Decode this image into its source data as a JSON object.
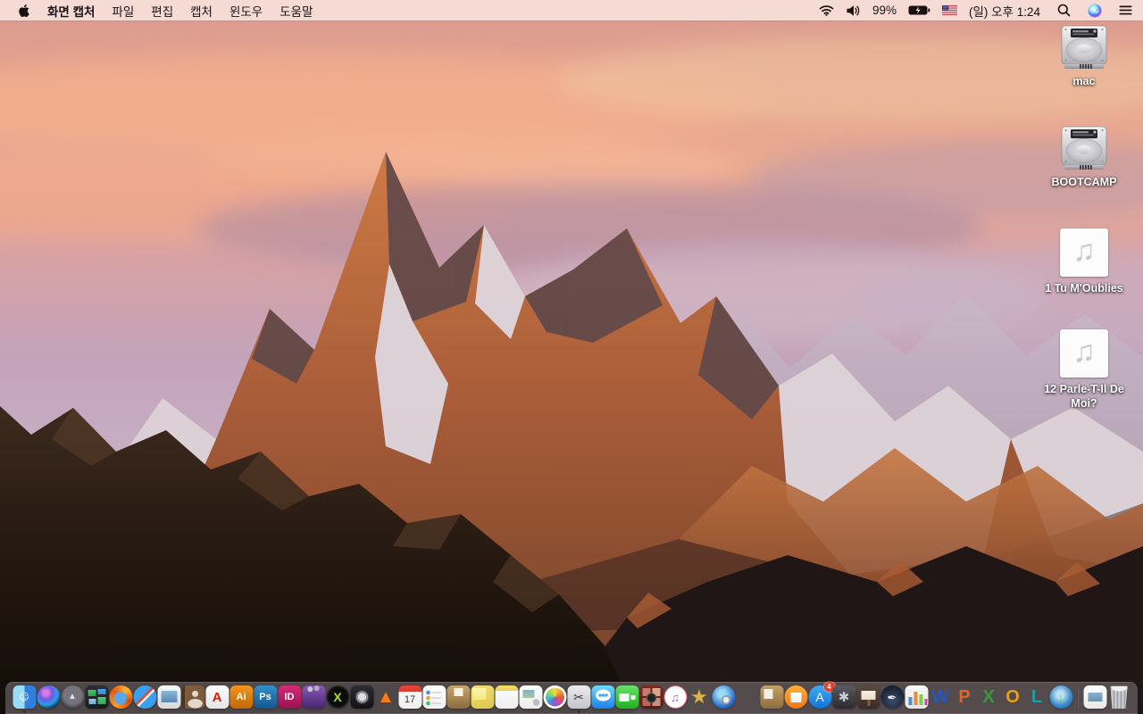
{
  "menu_bar": {
    "app_name": "화면 캡처",
    "menus": [
      "파일",
      "편집",
      "캡처",
      "윈도우",
      "도움말"
    ],
    "status": {
      "battery_percent": "99%",
      "clock": "(일) 오후 1:24",
      "icons": [
        "wifi-icon",
        "volume-icon",
        "battery-charging-icon",
        "us-flag-icon",
        "spotlight-icon",
        "siri-icon",
        "notification-center-icon"
      ]
    }
  },
  "desktop": {
    "icons": [
      {
        "label": "mac",
        "kind": "hard-drive"
      },
      {
        "label": "BOOTCAMP",
        "kind": "hard-drive"
      },
      {
        "label": "1 Tu M'Oublies",
        "kind": "audio-file"
      },
      {
        "label": "12 Parle-T-Il De Moi?",
        "kind": "audio-file"
      }
    ]
  },
  "wallpaper_palette": {
    "sky_top": "#e5a48f",
    "sky_lavender": "#c3a3ba",
    "cloud_pink": "#f4ae8d",
    "mountain_orange": "#c8743f",
    "snow": "#ded7de",
    "foreground_rock": "#241810",
    "menubar_tint": "#f7e0da"
  },
  "dock": {
    "items": [
      {
        "name": "finder",
        "shape": "sq",
        "bg": "linear-gradient(90deg,#9adcf8 0 50%,#2e7fe0 50% 100%)",
        "glyph": "☺",
        "fg": "#ffffff",
        "fs": 16,
        "running": true
      },
      {
        "name": "siri",
        "shape": "round",
        "bg": "radial-gradient(circle at 38% 32%,#e07ae0 0 12%,#6a5ae8 32%,#28a0e8 55%,#101c2e 82%)"
      },
      {
        "name": "launchpad",
        "shape": "round",
        "bg": "radial-gradient(circle at 50% 42%,#74747a 0 50%,#38383e 78%)",
        "glyph": "▲",
        "fg": "#e0e0e6",
        "fs": 10
      },
      {
        "name": "mission-control",
        "shape": "sq",
        "bg": "linear-gradient(#3ec862,#2aa04a) 3px 5px/9px 7px no-repeat,linear-gradient(#4aa8e8,#3a88c8) 14px 4px/9px 6px no-repeat,linear-gradient(#9ac8e8,#6aa8d8) 4px 15px/8px 6px no-repeat,linear-gradient(#52c878,#38a858) 14px 13px/9px 8px no-repeat,linear-gradient(#2e2e34,#1a1a20)"
      },
      {
        "name": "firefox",
        "shape": "round",
        "bg": "radial-gradient(circle at 48% 54%,#58a8e8 0 36%,rgba(0,0,0,0) 38%),conic-gradient(from 210deg,#ff9a1e,#e8580e 28%,#ffb83a 52%,#d84a08 74%,#ff9a1e)"
      },
      {
        "name": "safari",
        "shape": "round",
        "bg": "linear-gradient(135deg,rgba(0,0,0,0) 43%,#e8483c 43% 50%,#f8f8f8 50% 57%,rgba(0,0,0,0) 57%),radial-gradient(circle,#eaf4fc 0 10%,#38a0ee 11% 100%)"
      },
      {
        "name": "preview",
        "shape": "sq",
        "bg": "linear-gradient(#8ab8da,#5a88b2) 4px 6px/18px 13px no-repeat,linear-gradient(#fafafa,#d8d8d8)"
      },
      {
        "name": "contacts",
        "shape": "sq",
        "bg": "radial-gradient(circle at 58% 36%,#e2d6c6 0 15%,rgba(0,0,0,0) 16%),radial-gradient(ellipse 32% 20% at 58% 78%,#e2d6c6 0 99%,rgba(0,0,0,0) 100%),linear-gradient(90deg,#4a3422 0 14%,#7d5c3c 14% 100%)"
      },
      {
        "name": "acrobat-reader",
        "shape": "sq",
        "bg": "linear-gradient(#fdfdfd,#e6e6e6)",
        "glyph": "A",
        "fg": "#d4200e",
        "fs": 15,
        "bold": true
      },
      {
        "name": "adobe-illustrator",
        "shape": "sq",
        "bg": "linear-gradient(#f2951e,#c06808)",
        "glyph": "Ai",
        "fg": "#ffffff",
        "fs": 11,
        "bold": true
      },
      {
        "name": "adobe-photoshop",
        "shape": "sq",
        "bg": "linear-gradient(#3290cc,#16568e)",
        "glyph": "Ps",
        "fg": "#ffffff",
        "fs": 11,
        "bold": true
      },
      {
        "name": "adobe-indesign",
        "shape": "sq",
        "bg": "linear-gradient(#d62a78,#96134e)",
        "glyph": "ID",
        "fg": "#ffffff",
        "fs": 11,
        "bold": true
      },
      {
        "name": "toast-titanium",
        "shape": "sq",
        "bg": "radial-gradient(circle at 34% 16%,#c8c8d2 0 10%,rgba(0,0,0,0) 11%),radial-gradient(circle at 62% 12%,#b0b0c0 0 10%,rgba(0,0,0,0) 11%),linear-gradient(#8a5ab8,#44266e)"
      },
      {
        "name": "media-converter-x",
        "shape": "round",
        "bg": "radial-gradient(circle at 50% 50%,#0c0c0c 0 58%,#3c3c3c 74%)",
        "glyph": "X",
        "fg": "#aadc28",
        "fs": 14,
        "bold": true
      },
      {
        "name": "disc-utility-app",
        "shape": "sq",
        "bg": "radial-gradient(circle at 50% 50%,#dcdce4 0 24%,#8c8c94 25% 36%,#3c3c42 37% 42%,rgba(0,0,0,0) 43%),linear-gradient(#2c2c32,#121216)"
      },
      {
        "name": "vlc",
        "shape": "none",
        "glyph": "▲",
        "fg": "#ff7a14",
        "fs": 20
      },
      {
        "name": "calendar",
        "shape": "sq",
        "bg": "linear-gradient(#e8463c,#d83a30) 0 0/100% 7px no-repeat,linear-gradient(#fdfdfd,#efefef)",
        "glyph": "17",
        "fg": "#333333",
        "fs": 11,
        "pt": 6
      },
      {
        "name": "reminders",
        "shape": "sq",
        "bg": "radial-gradient(circle at 6px 8px,#4a90e8 0 2px,rgba(0,0,0,0) 2.6px),radial-gradient(circle at 6px 14px,#e8a03a 0 2px,rgba(0,0,0,0) 2.6px),radial-gradient(circle at 6px 20px,#3ac85a 0 2px,rgba(0,0,0,0) 2.6px),linear-gradient(#dcdcdc,#dcdcdc) 10px 7px/11px 2px no-repeat,linear-gradient(#dcdcdc,#dcdcdc) 10px 13px/11px 2px no-repeat,linear-gradient(#dcdcdc,#dcdcdc) 10px 19px/11px 2px no-repeat,linear-gradient(#ffffff,#f0f0f0)"
      },
      {
        "name": "stuffit-expander",
        "shape": "sq",
        "bg": "linear-gradient(#f6f2e8,#f6f2e8) 8px 3px/10px 9px no-repeat,linear-gradient(#c8a86c,#8a6a3c)"
      },
      {
        "name": "stickies",
        "shape": "sq",
        "bg": "linear-gradient(#fdf6b2,#f6e87e) 2px 3px/15px 13px no-repeat,linear-gradient(155deg,#f2e278,#dcc44a)"
      },
      {
        "name": "notes",
        "shape": "sq",
        "bg": "linear-gradient(#f5df6a,#eccf55) 0 0/100% 6px no-repeat,linear-gradient(#fefefe,#ededed)"
      },
      {
        "name": "document-viewer-app",
        "shape": "sq",
        "bg": "radial-gradient(circle at 19px 19px,#b8bcc4 0 3.5px,rgba(0,0,0,0) 4px),linear-gradient(#7ab0d8,#a8cc88) 4px 5px/13px 9px no-repeat,linear-gradient(#ffffff,#eaeaea)"
      },
      {
        "name": "photos",
        "shape": "round",
        "bg": "radial-gradient(circle,rgba(0,0,0,0) 0 56%,#ffffff 57%),conic-gradient(#f8d84a,#f0983a,#e85a3c,#d84a8a,#8a5ad8,#4a8ad8,#4ac8b8,#a8d84a,#f8d84a)"
      },
      {
        "name": "grab-screen-capture",
        "shape": "sq",
        "bg": "linear-gradient(#ececf0,#c2c2ca)",
        "glyph": "✂",
        "fg": "#3a3a3e",
        "fs": 14,
        "running": true
      },
      {
        "name": "messages",
        "shape": "sq",
        "bg": "radial-gradient(circle at 9.5px 11px,#49a8f0 0 1.6px,rgba(0,0,0,0) 2px),radial-gradient(circle at 13px 11px,#49a8f0 0 1.6px,rgba(0,0,0,0) 2px),radial-gradient(circle at 16.5px 11px,#49a8f0 0 1.6px,rgba(0,0,0,0) 2px),radial-gradient(ellipse 8.5px 6.5px at 13px 11px,#ffffff 0 99%,rgba(0,0,0,0) 100%),linear-gradient(#6adcfc,#1d7fe8)"
      },
      {
        "name": "facetime",
        "shape": "sq",
        "bg": "linear-gradient(#ffffff,#f2f2f2) 4px 9px/11px 9px no-repeat,linear-gradient(#ffffff,#f2f2f2) 17px 11px/5px 5px no-repeat,linear-gradient(#68e068,#22b022)"
      },
      {
        "name": "photo-booth",
        "shape": "sq",
        "bg": "radial-gradient(circle at 13px 14px,#222222 0 4.5px,#5a5a5a 4.5px 5.5px,rgba(0,0,0,0) 6px),linear-gradient(#c87a6a,#c87a6a) 3px 3px/9px 9px no-repeat,linear-gradient(#d8a88a,#d8a88a) 14px 3px/9px 9px no-repeat,linear-gradient(#b86a5a,#b86a5a) 3px 14px/9px 9px no-repeat,linear-gradient(#c8907a,#c8907a) 14px 14px/9px 9px no-repeat,linear-gradient(#7a2a22,#581a12)"
      },
      {
        "name": "itunes",
        "shape": "round",
        "bg": "radial-gradient(circle,#ffffff 0 64%,#e86a84 66%)",
        "glyph": "♫",
        "fg": "#a858d8",
        "fs": 13
      },
      {
        "name": "imovie",
        "shape": "none",
        "glyph": "★",
        "fg": "#d8b44a",
        "fs": 22
      },
      {
        "name": "dvd-ripper-app",
        "shape": "round",
        "bg": "radial-gradient(circle at 60% 62%,#ececf0 0 14%,#9a9aa4 15% 22%,rgba(0,0,0,0) 23%),radial-gradient(circle at 42% 36%,#9adcf8 0 18%,#2a6ac8 66%,#184a90 100%)"
      },
      {
        "name": "garageband",
        "shape": "none",
        "bg": "radial-gradient(circle at 38% 66%,#8a4a1c 0 24%,rgba(0,0,0,0) 25%),radial-gradient(circle at 46% 50%,#a45e24 0 17%,rgba(0,0,0,0) 18%),linear-gradient(28deg,rgba(0,0,0,0) 45%,#c89a5a 45% 53%,rgba(0,0,0,0) 53%)"
      },
      {
        "name": "archive-utility-app",
        "shape": "sq",
        "bg": "linear-gradient(#f2eee2,#f2eee2) 4px 4px/10px 11px no-repeat,linear-gradient(#c2a268,#8e6d3e)"
      },
      {
        "name": "ibooks",
        "shape": "round",
        "bg": "linear-gradient(#ffffff,#f0f0f0) 7px 8px/12px 11px no-repeat,linear-gradient(#ffb03a,#f07414)"
      },
      {
        "name": "app-store",
        "shape": "round",
        "bg": "linear-gradient(#42aaf8,#1272d4)",
        "glyph": "A",
        "fg": "#ffffff",
        "fs": 14,
        "badge": "4"
      },
      {
        "name": "system-preferences",
        "shape": "sq",
        "bg": "linear-gradient(#5a5a62,#2a2a30)",
        "glyph": "✱",
        "fg": "#cacad2",
        "fs": 15
      },
      {
        "name": "keynote",
        "shape": "sq",
        "bg": "linear-gradient(#f5efe0,#e8dcc8) 5px 6px/16px 10px no-repeat,linear-gradient(#8a5a3a,#8a5a3a) 12px 16px/3px 7px no-repeat,linear-gradient(#5c4a42,#382c26)"
      },
      {
        "name": "pages",
        "shape": "round",
        "bg": "radial-gradient(circle at 50% 64%,#3c4c6e,#161e2c 78%)",
        "glyph": "✒",
        "fg": "#eaeaf0",
        "fs": 13
      },
      {
        "name": "numbers",
        "shape": "sq",
        "bg": "linear-gradient(#4a90d8,#4a90d8) 4px 13px/4px 9px no-repeat,linear-gradient(#e8893c,#e8893c) 10px 7px/4px 15px no-repeat,linear-gradient(#8ac84a,#8ac84a) 16px 10px/4px 12px no-repeat,linear-gradient(#c84aa8,#c84aa8) 22px 15px/3px 7px no-repeat,linear-gradient(#fafafa,#e4e4e4)"
      },
      {
        "name": "ms-word",
        "shape": "none",
        "glyph": "W",
        "fg": "#2456c8",
        "fs": 20,
        "bold": true
      },
      {
        "name": "ms-powerpoint",
        "shape": "none",
        "glyph": "P",
        "fg": "#e8641e",
        "fs": 20,
        "bold": true
      },
      {
        "name": "ms-excel",
        "shape": "none",
        "glyph": "X",
        "fg": "#3a9a3a",
        "fs": 20,
        "bold": true
      },
      {
        "name": "ms-outlook",
        "shape": "none",
        "glyph": "O",
        "fg": "#e8a018",
        "fs": 20,
        "bold": true
      },
      {
        "name": "ms-lync",
        "shape": "none",
        "glyph": "L",
        "fg": "#18a0a8",
        "fs": 20,
        "bold": true
      },
      {
        "name": "web-download-app",
        "shape": "round",
        "bg": "radial-gradient(circle at 45% 40%,#bce2f2 0 18%,#3a88c8 58%,#1a5898 100%)",
        "glyph": "↓",
        "fg": "#46e046",
        "fs": 14,
        "bold": true
      },
      {
        "separator": true
      },
      {
        "name": "image-file",
        "shape": "sq",
        "bg": "linear-gradient(#8ab2d2,#6892b2) 5px 8px/16px 10px no-repeat,linear-gradient(#fdfdfd,#e9e9e9)"
      },
      {
        "name": "trash",
        "shape": "sq",
        "cls": "trash-shape",
        "bg": "radial-gradient(ellipse 9px 4px at 13px 2.5px,#f2f2f4 0 99%,rgba(0,0,0,0) 100%),repeating-linear-gradient(90deg,#d2d2d8 0 2px,#a0a0a8 2px 4px)"
      }
    ]
  }
}
